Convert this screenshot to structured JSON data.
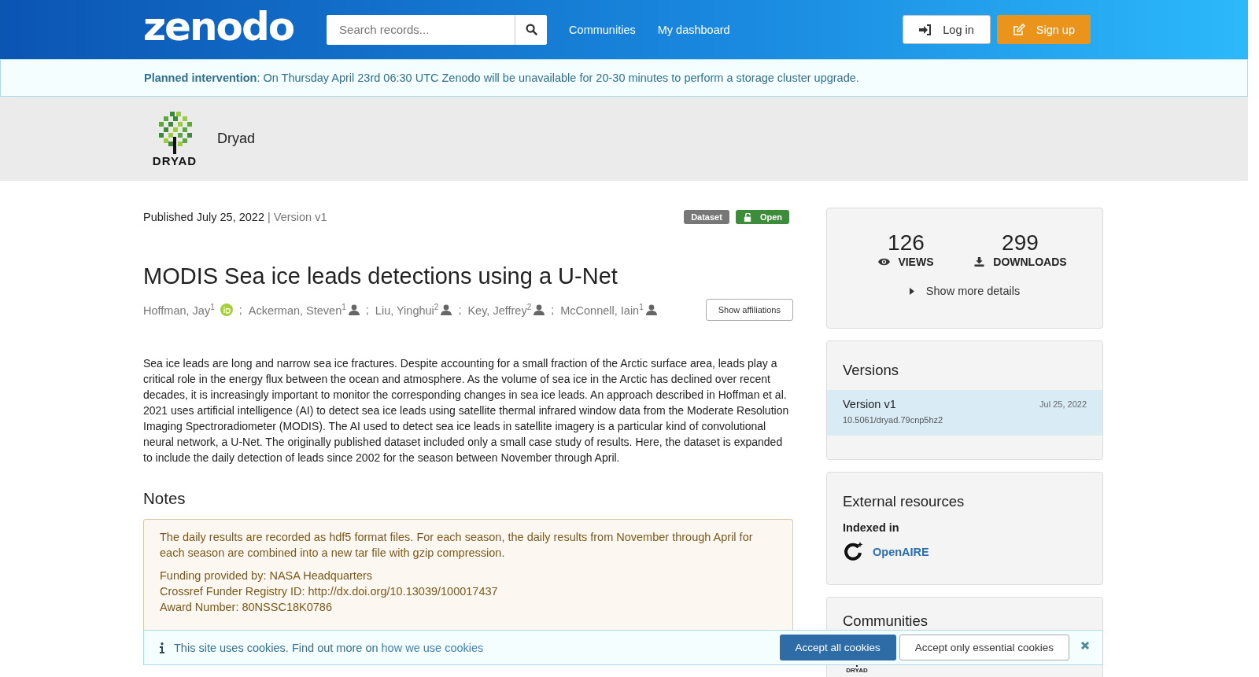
{
  "header": {
    "logo": "zenodo",
    "search": {
      "placeholder": "Search records..."
    },
    "nav": [
      "Communities",
      "My dashboard"
    ],
    "login": "Log in",
    "signup": "Sign up"
  },
  "banner": {
    "title": "Planned intervention",
    "text": ": On Thursday April 23rd 06:30 UTC Zenodo will be unavailable for 20-30 minutes to perform a storage cluster upgrade."
  },
  "community": {
    "logo_text": "DRYAD",
    "name": "Dryad"
  },
  "record": {
    "published": "Published July 25, 2022",
    "version": "| Version v1",
    "badges": [
      {
        "kind": "type",
        "label": "Dataset"
      },
      {
        "kind": "access",
        "label": "Open"
      }
    ],
    "title": "MODIS Sea ice leads detections using a U-Net",
    "authors": [
      {
        "name": "Hoffman, Jay",
        "sup": "1",
        "kind": "orcid",
        "separator": ";"
      },
      {
        "name": "Ackerman, Steven",
        "sup": "1",
        "kind": "person",
        "separator": ";"
      },
      {
        "name": "Liu, Yinghui",
        "sup": "2",
        "kind": "person",
        "separator": ";"
      },
      {
        "name": "Key, Jeffrey",
        "sup": "2",
        "kind": "person",
        "separator": ";"
      },
      {
        "name": "McConnell, Iain",
        "sup": "1",
        "kind": "person"
      }
    ],
    "affiliations_button": "Show affiliations",
    "abstract": "Sea ice leads are long and narrow sea ice fractures. Despite accounting for a small fraction of the Arctic surface area, leads play a critical role in the energy flux between the ocean and atmosphere. As the volume of sea ice in the Arctic has declined over recent decades, it is increasingly important to monitor the corresponding changes in sea ice leads. An approach described in Hoffman et al. 2021 uses artificial intelligence (AI) to detect sea ice leads using satellite thermal infrared window data from the Moderate Resolution Imaging Spectroradiometer (MODIS). The AI used to detect sea ice leads in satellite imagery is a particular kind of convolutional neural network, a U-Net. The originally published dataset included only a small case study of results. Here, the dataset is expanded to include the daily detection of leads since 2002 for the season between November through April.",
    "notes_heading": "Notes",
    "notes": [
      "The daily results are recorded as hdf5 format files. For each season, the daily results from November through April for each season are combined into a new tar file with gzip compression.",
      "Funding provided by: NASA Headquarters\nCrossref Funder Registry ID: http://dx.doi.org/10.13039/100017437\nAward Number: 80NSSC18K0786"
    ]
  },
  "stats": [
    {
      "kind": "views",
      "value": "126",
      "label": "VIEWS"
    },
    {
      "kind": "downloads",
      "value": "299",
      "label": "DOWNLOADS"
    }
  ],
  "more_details": "Show more details",
  "versions": {
    "heading": "Versions",
    "items": [
      {
        "label": "Version v1",
        "date": "Jul 25, 2022",
        "doi": "10.5061/dryad.79cnp5hz2",
        "selected": true
      }
    ]
  },
  "external": {
    "heading": "External resources",
    "subheading": "Indexed in",
    "link": "OpenAIRE"
  },
  "communities": {
    "heading": "Communities",
    "logo_text": "DRYAD"
  },
  "cookies": {
    "text": "This site uses cookies. Find out more on ",
    "link": "how we use cookies",
    "accept_all": "Accept all cookies",
    "accept_essential": "Accept only essential cookies"
  }
}
